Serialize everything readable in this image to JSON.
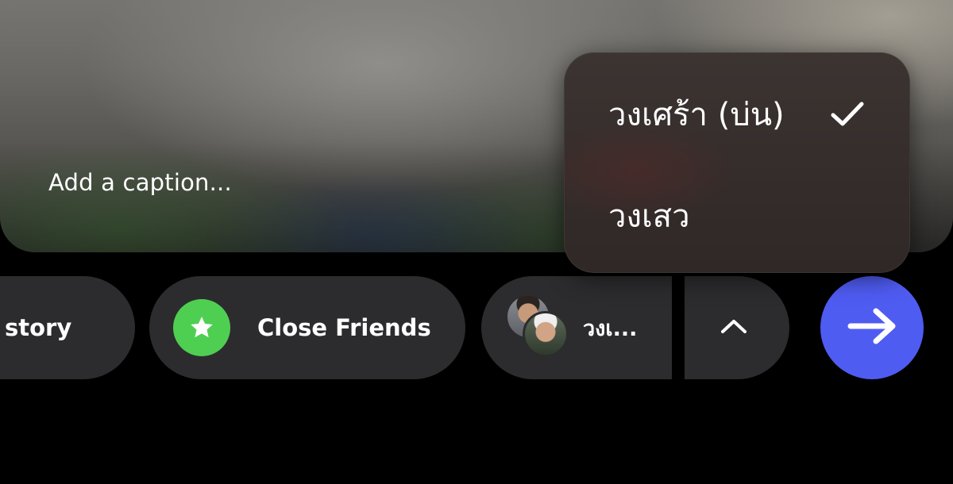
{
  "caption": {
    "placeholder": "Add a caption..."
  },
  "share_bar": {
    "story_label": "story",
    "close_friends_label": "Close Friends",
    "group_label": "วงเ...",
    "expand_icon": "chevron-up-icon",
    "send_icon": "arrow-right-icon"
  },
  "group_menu": {
    "items": [
      {
        "label": "วงเศร้า (บ่น)",
        "selected": true
      },
      {
        "label": "วงเสว",
        "selected": false
      }
    ]
  },
  "colors": {
    "close_friends_green": "#4fcf52",
    "send_blue": "#4f5cf2",
    "pill_bg": "#2c2c2e"
  }
}
